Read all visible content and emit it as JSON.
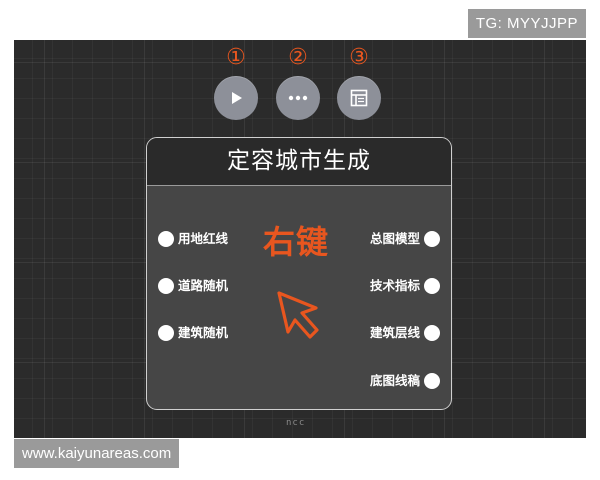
{
  "watermarks": {
    "top": "TG: MYYJJPP",
    "bottom": "www.kaiyunareas.com"
  },
  "toolbar": {
    "markers": [
      "①",
      "②",
      "③"
    ],
    "buttons": [
      {
        "icon": "play-icon"
      },
      {
        "icon": "more-icon"
      },
      {
        "icon": "panel-icon"
      }
    ]
  },
  "node": {
    "title": "定容城市生成",
    "inputs": [
      "用地红线",
      "道路随机",
      "建筑随机"
    ],
    "outputs": [
      "总图模型",
      "技术指标",
      "建筑层线",
      "底图线稿"
    ]
  },
  "annotation": {
    "text": "右键",
    "icon": "cursor-arrow-icon"
  },
  "canvas_logo": "ncc",
  "colors": {
    "accent": "#e8561f",
    "canvas": "#2b2b2b",
    "node_body": "#464646",
    "node_header": "#2a2a2a",
    "button": "#8d9099"
  }
}
